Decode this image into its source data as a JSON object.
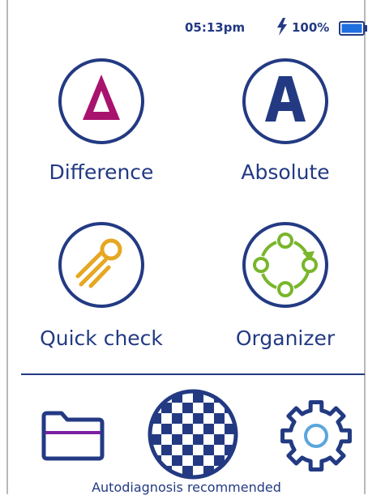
{
  "status_bar": {
    "time": "05:13pm",
    "battery_percent": "100%",
    "battery_level": 1.0,
    "charging_icon": "lightning-bolt-icon",
    "battery_icon": "battery-icon"
  },
  "colors": {
    "navy": "#233a83",
    "magenta": "#a8136e",
    "orange": "#e6a722",
    "green": "#79b62b",
    "light_blue": "#5aa6dd",
    "purple_line": "#7b1fa2"
  },
  "modes": [
    {
      "label": "Difference",
      "icon": "delta-icon",
      "glyph": "Δ"
    },
    {
      "label": "Absolute",
      "icon": "letter-a-icon",
      "glyph": "A"
    },
    {
      "label": "Quick check",
      "icon": "comet-icon"
    },
    {
      "label": "Organizer",
      "icon": "cycle-icon"
    }
  ],
  "bottom_bar": [
    {
      "icon": "folder-icon"
    },
    {
      "icon": "checkerboard-icon"
    },
    {
      "icon": "gear-icon"
    }
  ],
  "notice": "Autodiagnosis recommended"
}
